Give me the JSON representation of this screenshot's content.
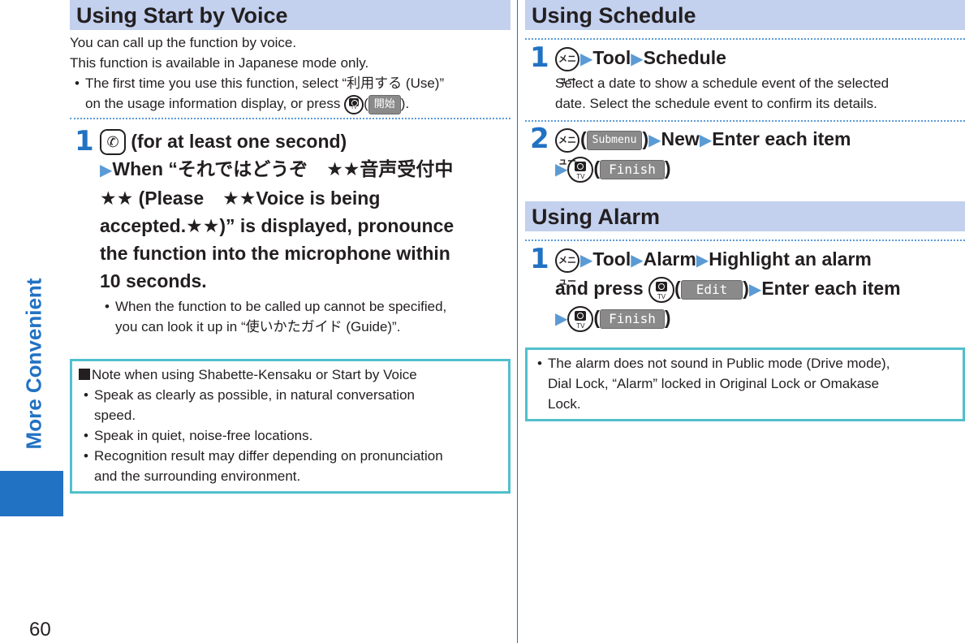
{
  "sidebar": {
    "chapter_label": "More Convenient",
    "page_number": "60",
    "accent_color": "#2272c3"
  },
  "left": {
    "title": "Using Start by Voice",
    "intro": [
      "You can call up the function by voice.",
      "This function is available in Japanese mode only."
    ],
    "intro_bullet_a": "The first time you use this function, select “利用する (Use)”",
    "intro_bullet_b": "on the usage information display, or press",
    "intro_softkey": "開始",
    "step1": {
      "num": "1",
      "line1": "(for at least one second)",
      "line2": "When “それではどうぞ　★★音声受付中",
      "line3": "★★ (Please　★★Voice is being",
      "line4": "accepted.★★)” is displayed, pronounce",
      "line5": "the function into the microphone within",
      "line6": "10 seconds.",
      "bullet_a": "When the function to be called up cannot be specified,",
      "bullet_b": "you can look it up in “使いかたガイド (Guide)”."
    },
    "note": {
      "heading": "Note when using Shabette-Kensaku or Start by Voice",
      "items": [
        [
          "Speak as clearly as possible, in natural conversation",
          "speed."
        ],
        [
          "Speak in quiet, noise-free locations."
        ],
        [
          "Recognition result may differ depending on pronunciation",
          "and the surrounding environment."
        ]
      ]
    }
  },
  "right": {
    "schedule": {
      "title": "Using Schedule",
      "step1": {
        "num": "1",
        "path": [
          "Tool",
          "Schedule"
        ],
        "desc": [
          "Select a date to show a schedule event of the selected",
          "date. Select the schedule event to confirm its details."
        ]
      },
      "step2": {
        "num": "2",
        "softkey": "Submenu",
        "path": [
          "New",
          "Enter each item"
        ],
        "finish": "Finish"
      }
    },
    "alarm": {
      "title": "Using Alarm",
      "step1": {
        "num": "1",
        "path": [
          "Tool",
          "Alarm",
          "Highlight an alarm"
        ],
        "line2a": "and press",
        "softkey": "Edit",
        "line2b": "Enter each item",
        "finish": "Finish"
      },
      "note": [
        "The alarm does not sound in Public mode (Drive mode),",
        "Dial Lock, “Alarm” locked in Original Lock or Omakase",
        "Lock."
      ]
    }
  },
  "icons": {
    "menu_key": "メニュー",
    "camera_key_label": "TV",
    "call_key": "✆",
    "arrow": "▶"
  }
}
